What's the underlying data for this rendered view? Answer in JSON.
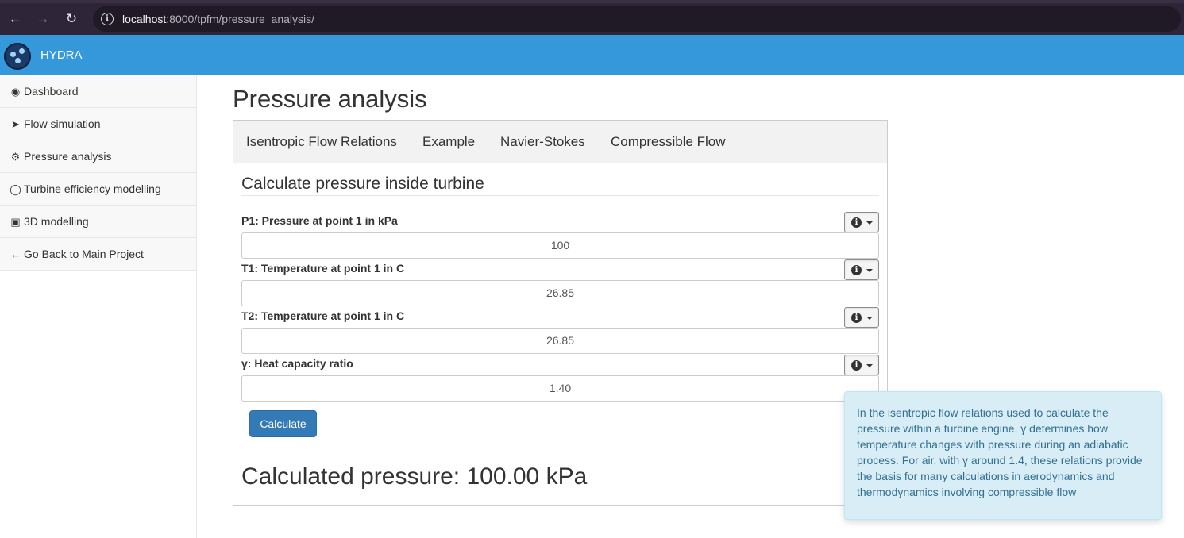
{
  "browser": {
    "url_host": "localhost",
    "url_path": ":8000/tpfm/pressure_analysis/"
  },
  "navbar": {
    "brand": "HYDRA"
  },
  "sidebar": {
    "items": [
      {
        "label": "Dashboard",
        "icon": "dashboard-icon"
      },
      {
        "label": "Flow simulation",
        "icon": "pin-icon"
      },
      {
        "label": "Pressure analysis",
        "icon": "gear-icon"
      },
      {
        "label": "Turbine efficiency modelling",
        "icon": "user-icon"
      },
      {
        "label": "3D modelling",
        "icon": "cube-icon"
      },
      {
        "label": "Go Back to Main Project",
        "icon": "arrow-left-icon"
      }
    ]
  },
  "main": {
    "title": "Pressure analysis",
    "tabs": [
      "Isentropic Flow Relations",
      "Example",
      "Navier-Stokes",
      "Compressible Flow"
    ],
    "section_title": "Calculate pressure inside turbine",
    "fields": [
      {
        "label": "P1: Pressure at point 1 in kPa",
        "value": "100"
      },
      {
        "label": "T1: Temperature at point 1 in C",
        "value": "26.85"
      },
      {
        "label": "T2: Temperature at point 1 in C",
        "value": "26.85"
      },
      {
        "label": "γ: Heat capacity ratio",
        "value": "1.40"
      }
    ],
    "calculate_label": "Calculate",
    "result": "Calculated pressure: 100.00 kPa"
  },
  "tooltip": {
    "text": "In the isentropic flow relations used to calculate the pressure within a turbine engine, γ determines how temperature changes with pressure during an adiabatic process. For air, with γ around 1.4, these relations provide the basis for many calculations in aerodynamics and thermodynamics involving compressible flow"
  },
  "colors": {
    "navbar": "#3498db",
    "primary_button": "#337ab7",
    "tooltip_bg": "#d9edf7"
  }
}
